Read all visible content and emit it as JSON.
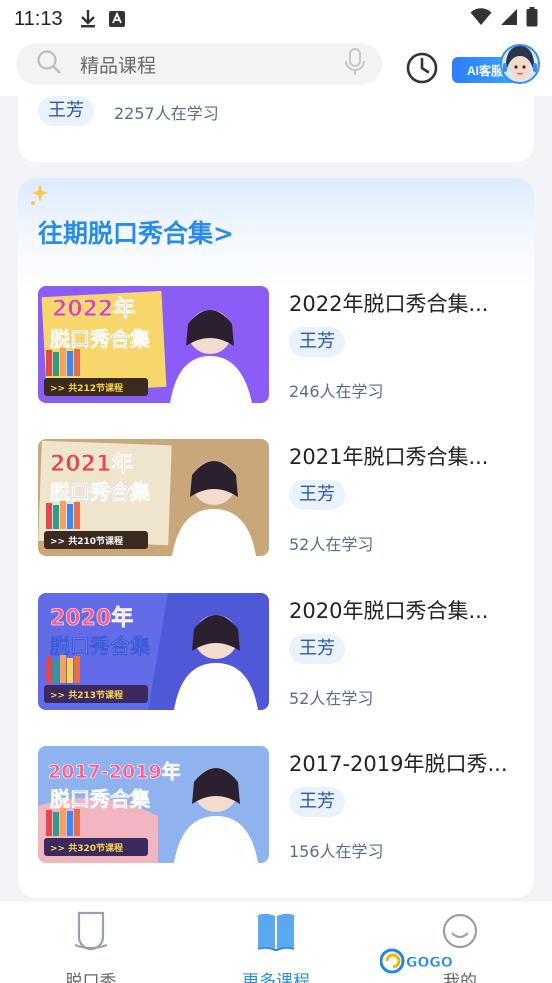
{
  "status_bar": {
    "time": "11:13"
  },
  "search": {
    "placeholder": "精品课程"
  },
  "ai_service": {
    "label": "AI客服"
  },
  "top_card": {
    "teacher_tag": "王芳",
    "learners": "2257人在学习"
  },
  "collection": {
    "title": "往期脱口秀合集>",
    "courses": [
      {
        "title": "2022年脱口秀合集...",
        "teacher": "王芳",
        "learners": "246人在学习",
        "thumb": {
          "year": "2022年",
          "subtitle": "脱口秀合集",
          "count": ">> 共212节课程",
          "bg": "#8b5cf6"
        }
      },
      {
        "title": "2021年脱口秀合集...",
        "teacher": "王芳",
        "learners": "52人在学习",
        "thumb": {
          "year": "2021年",
          "subtitle": "脱口秀合集",
          "count": ">> 共210节课程",
          "bg": "#c9a77a"
        }
      },
      {
        "title": "2020年脱口秀合集...",
        "teacher": "王芳",
        "learners": "52人在学习",
        "thumb": {
          "year": "2020年",
          "subtitle": "脱口秀合集",
          "count": ">> 共213节课程",
          "bg": "#4f59d8"
        }
      },
      {
        "title": "2017-2019年脱口秀...",
        "teacher": "王芳",
        "learners": "156人在学习",
        "thumb": {
          "year": "2017-2019年",
          "subtitle": "脱口秀合集",
          "count": ">> 共320节课程",
          "bg": "#8fb3ee"
        }
      }
    ]
  },
  "bottom_nav": {
    "items": [
      {
        "label": "脱口秀",
        "icon": "talkshow-icon",
        "active": false
      },
      {
        "label": "更多课程",
        "icon": "book-icon",
        "active": true
      },
      {
        "label": "我的",
        "icon": "profile-icon",
        "active": false
      }
    ]
  },
  "watermark": {
    "text": "GOGO手游网"
  },
  "colors": {
    "accent": "#2a8be8",
    "tag_bg": "#eaf2fd",
    "tag_text": "#2f5aa8",
    "nav_active": "#2a8be8",
    "nav_inactive": "#666666"
  }
}
